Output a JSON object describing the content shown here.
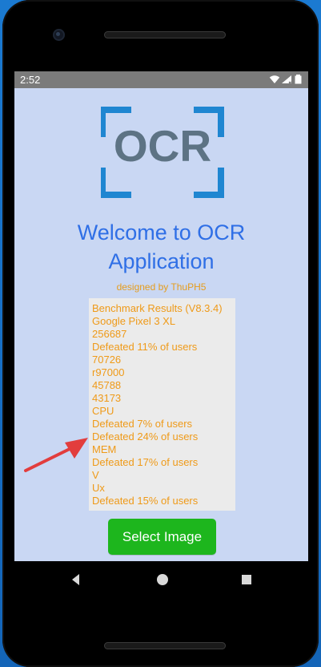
{
  "status_bar": {
    "time": "2:52",
    "icons": [
      "wifi-icon",
      "signal-icon",
      "battery-icon"
    ]
  },
  "logo": {
    "text": "OCR"
  },
  "header": {
    "title_line1": "Welcome to OCR",
    "title_line2": "Application",
    "subtitle": "designed by ThuPH5"
  },
  "results": {
    "lines": [
      "Benchmark Results (V8.3.4)",
      "Google Pixel 3 XL",
      "256687",
      "Defeated 11% of users",
      "70726",
      "r97000",
      "45788",
      "43173",
      "CPU",
      "Defeated 7% of users",
      "Defeated 24% of users",
      "MEM",
      "Defeated 17% of users",
      "V",
      "Ux",
      "Defeated 15% of users"
    ]
  },
  "actions": {
    "select_image_label": "Select Image"
  },
  "navigation": {
    "buttons": [
      "back-icon",
      "home-icon",
      "recents-icon"
    ]
  },
  "colors": {
    "phone_frame": "#000000",
    "outer_background": "#1673c9",
    "screen_background": "#c9d7f3",
    "status_bar": "#7b7b7b",
    "logo_corners": "#1f86d1",
    "logo_text": "#5d7384",
    "title": "#2f6fe6",
    "subtitle": "#e59d1e",
    "results_text": "#ef9a18",
    "results_panel": "#ebebeb",
    "primary_button": "#1db61d",
    "annotation_arrow": "#e23d3d"
  }
}
